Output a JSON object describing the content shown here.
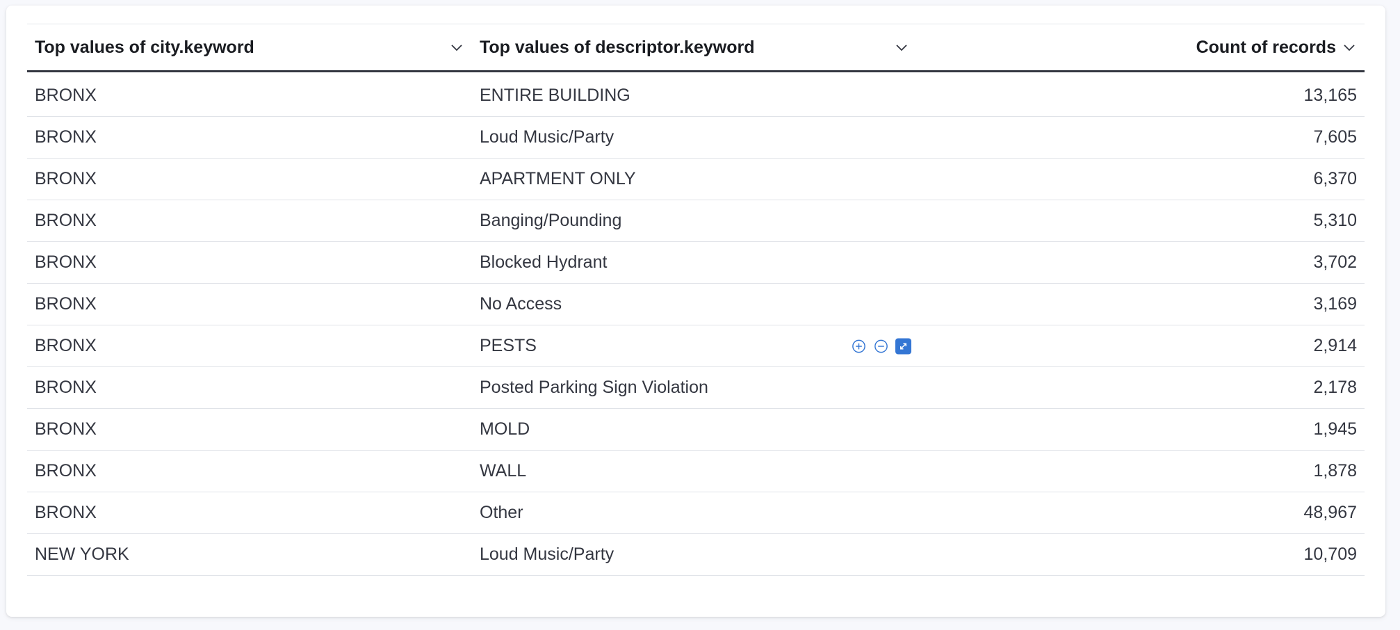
{
  "table": {
    "headers": [
      {
        "label": "Top values of city.keyword",
        "align": "left"
      },
      {
        "label": "Top values of descriptor.keyword",
        "align": "left"
      },
      {
        "label": "Count of records",
        "align": "right"
      }
    ],
    "rows": [
      {
        "city": "BRONX",
        "descriptor": "ENTIRE BUILDING",
        "count": "13,165"
      },
      {
        "city": "BRONX",
        "descriptor": "Loud Music/Party",
        "count": "7,605"
      },
      {
        "city": "BRONX",
        "descriptor": "APARTMENT ONLY",
        "count": "6,370"
      },
      {
        "city": "BRONX",
        "descriptor": "Banging/Pounding",
        "count": "5,310"
      },
      {
        "city": "BRONX",
        "descriptor": "Blocked Hydrant",
        "count": "3,702"
      },
      {
        "city": "BRONX",
        "descriptor": "No Access",
        "count": "3,169"
      },
      {
        "city": "BRONX",
        "descriptor": "PESTS",
        "count": "2,914",
        "hovered": true
      },
      {
        "city": "BRONX",
        "descriptor": "Posted Parking Sign Violation",
        "count": "2,178"
      },
      {
        "city": "BRONX",
        "descriptor": "MOLD",
        "count": "1,945"
      },
      {
        "city": "BRONX",
        "descriptor": "WALL",
        "count": "1,878"
      },
      {
        "city": "BRONX",
        "descriptor": "Other",
        "count": "48,967"
      },
      {
        "city": "NEW YORK",
        "descriptor": "Loud Music/Party",
        "count": "10,709"
      }
    ],
    "cell_actions": [
      {
        "name": "filter-for-icon",
        "icon": "plus-in-circle"
      },
      {
        "name": "filter-out-icon",
        "icon": "minus-in-circle"
      },
      {
        "name": "expand-icon",
        "icon": "expand-arrows"
      }
    ]
  },
  "colors": {
    "text": "#343741",
    "header_text": "#1a1c21",
    "header_border": "#343741",
    "row_border": "#e0e3e8",
    "accent": "#3476d4",
    "background": "#f7f8fc",
    "panel": "#ffffff"
  }
}
